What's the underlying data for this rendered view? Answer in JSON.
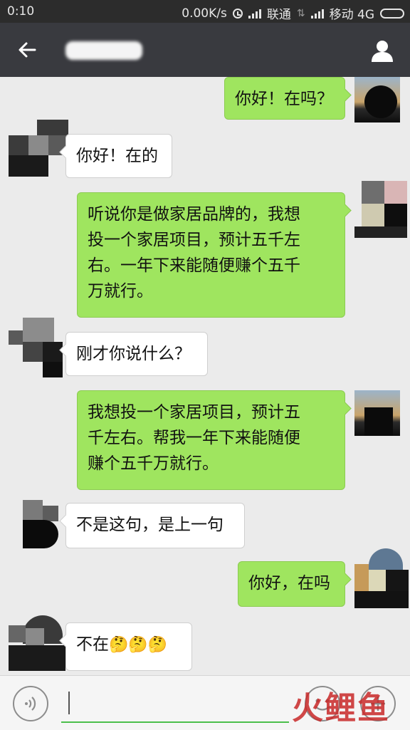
{
  "status_bar": {
    "time": "0:10",
    "speed": "0.00K/s",
    "carrier1": "联通",
    "carrier2": "移动 4G"
  },
  "header": {
    "title": "",
    "back_icon": "arrow-left-icon",
    "profile_icon": "person-icon"
  },
  "messages": [
    {
      "side": "out",
      "text": "你好！在吗？"
    },
    {
      "side": "in",
      "text": "你好！在的"
    },
    {
      "side": "out",
      "lines": [
        "听说你是做家居品牌的，我想",
        "投一个家居项目，预计五千左",
        "右。一年下来能随便赚个五千",
        "万就行。"
      ]
    },
    {
      "side": "in",
      "text": "刚才你说什么？"
    },
    {
      "side": "out",
      "lines": [
        "我想投一个家居项目，预计五",
        "千左右。帮我一年下来能随便",
        "赚个五千万就行。"
      ]
    },
    {
      "side": "in",
      "text": "不是这句，是上一句"
    },
    {
      "side": "out",
      "text": "你好，在吗"
    },
    {
      "side": "in",
      "text": "不在",
      "emojis": [
        "🤔",
        "🤔",
        "🤔"
      ]
    }
  ],
  "input_bar": {
    "voice_icon": "voice-icon",
    "emoji_icon": "smiley-icon",
    "plus_icon": "plus-icon",
    "value": ""
  },
  "watermark": "火鲤鱼",
  "colors": {
    "outgoing_bubble": "#9fe55f",
    "incoming_bubble": "#ffffff",
    "header_bg": "#393a3f",
    "chat_bg": "#ebebeb"
  }
}
